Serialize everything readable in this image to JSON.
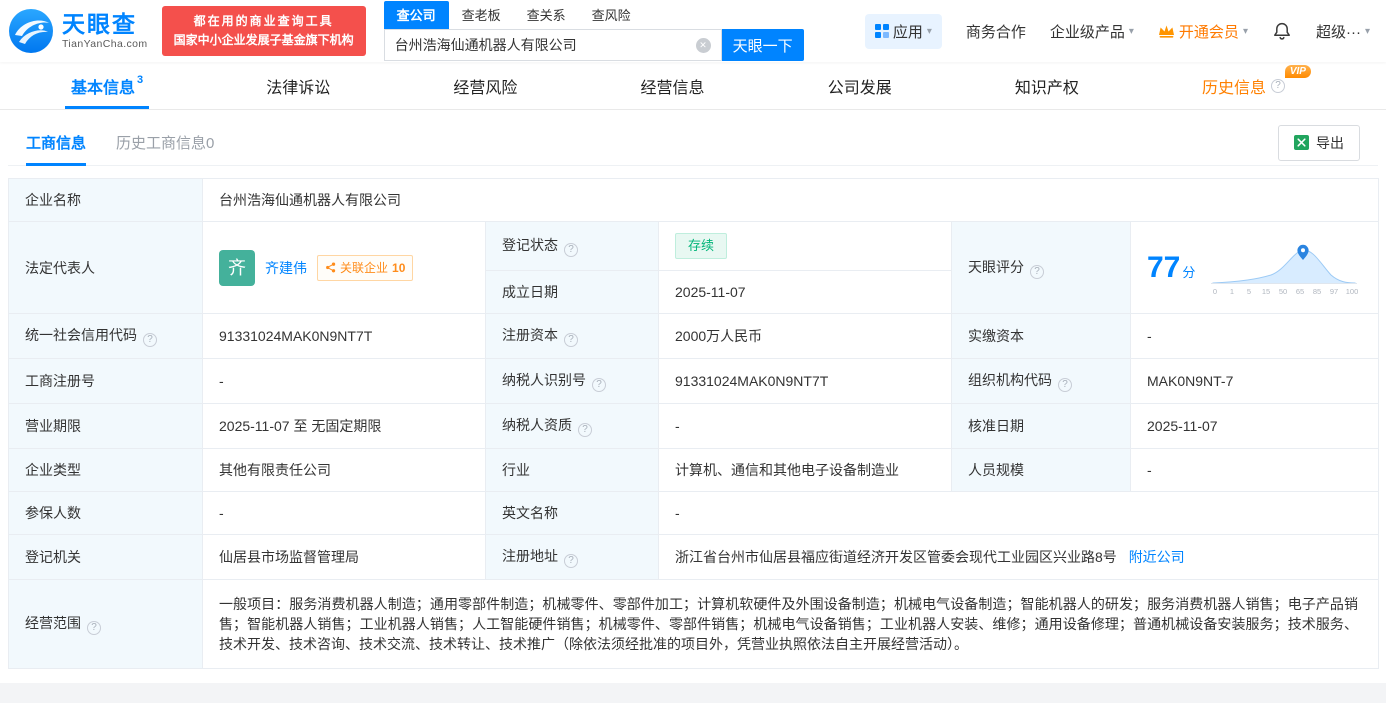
{
  "icons": {
    "help": "?",
    "caret_down": "▾",
    "clear": "✕"
  },
  "colors": {
    "brand_blue": "#0084ff",
    "vip_orange": "#ff8000",
    "status_green": "#00b579",
    "badge_red": "#f4504c"
  },
  "header": {
    "logo": {
      "brand": "天眼查",
      "domain": "TianYanCha.com"
    },
    "slogan": {
      "line1": "都在用的商业查询工具",
      "line2": "国家中小企业发展子基金旗下机构"
    },
    "search_tabs": [
      {
        "label": "查公司"
      },
      {
        "label": "查老板"
      },
      {
        "label": "查关系"
      },
      {
        "label": "查风险"
      }
    ],
    "search": {
      "value": "台州浩海仙通机器人有限公司",
      "button": "天眼一下"
    },
    "menu": {
      "apps": "应用",
      "business_coop": "商务合作",
      "enterprise_products": "企业级产品",
      "open_vip": "开通会员",
      "super": "超级···"
    }
  },
  "nav_tabs": [
    {
      "label": "基本信息",
      "badge": "3"
    },
    {
      "label": "法律诉讼"
    },
    {
      "label": "经营风险"
    },
    {
      "label": "经营信息"
    },
    {
      "label": "公司发展"
    },
    {
      "label": "知识产权"
    },
    {
      "label": "历史信息",
      "vip": "VIP"
    }
  ],
  "sub_tabs": {
    "active": "工商信息",
    "history": "历史工商信息0"
  },
  "toolbar": {
    "export_label": "导出"
  },
  "info": {
    "company_name": {
      "label": "企业名称",
      "value": "台州浩海仙通机器人有限公司"
    },
    "legal_rep": {
      "label": "法定代表人",
      "avatar": "齐",
      "name": "齐建伟",
      "related_label": "关联企业",
      "related_count": "10"
    },
    "reg_status": {
      "label": "登记状态",
      "value": "存续"
    },
    "establish_date": {
      "label": "成立日期",
      "value": "2025-11-07"
    },
    "score": {
      "label": "天眼评分",
      "value": "77",
      "unit": "分",
      "ticks": [
        "0",
        "1",
        "5",
        "15",
        "50",
        "65",
        "85",
        "97",
        "100"
      ]
    },
    "credit_code": {
      "label": "统一社会信用代码",
      "value": "91331024MAK0N9NT7T"
    },
    "reg_capital": {
      "label": "注册资本",
      "value": "2000万人民币"
    },
    "paid_capital": {
      "label": "实缴资本",
      "value": "-"
    },
    "reg_no": {
      "label": "工商注册号",
      "value": "-"
    },
    "taxpayer_no": {
      "label": "纳税人识别号",
      "value": "91331024MAK0N9NT7T"
    },
    "org_code": {
      "label": "组织机构代码",
      "value": "MAK0N9NT-7"
    },
    "term": {
      "label": "营业期限",
      "value": "2025-11-07 至 无固定期限"
    },
    "taxpayer_quality": {
      "label": "纳税人资质",
      "value": "-"
    },
    "approve_date": {
      "label": "核准日期",
      "value": "2025-11-07"
    },
    "company_type": {
      "label": "企业类型",
      "value": "其他有限责任公司"
    },
    "industry": {
      "label": "行业",
      "value": "计算机、通信和其他电子设备制造业"
    },
    "staff_size": {
      "label": "人员规模",
      "value": "-"
    },
    "insured": {
      "label": "参保人数",
      "value": "-"
    },
    "english_name": {
      "label": "英文名称",
      "value": "-"
    },
    "authority": {
      "label": "登记机关",
      "value": "仙居县市场监督管理局"
    },
    "address": {
      "label": "注册地址",
      "value": "浙江省台州市仙居县福应街道经济开发区管委会现代工业园区兴业路8号",
      "nearby": "附近公司"
    },
    "scope": {
      "label": "经营范围",
      "value": "一般项目：服务消费机器人制造；通用零部件制造；机械零件、零部件加工；计算机软硬件及外围设备制造；机械电气设备制造；智能机器人的研发；服务消费机器人销售；电子产品销售；智能机器人销售；工业机器人销售；人工智能硬件销售；机械零件、零部件销售；机械电气设备销售；工业机器人安装、维修；通用设备修理；普通机械设备安装服务；技术服务、技术开发、技术咨询、技术交流、技术转让、技术推广（除依法须经批准的项目外，凭营业执照依法自主开展经营活动）。"
    }
  }
}
